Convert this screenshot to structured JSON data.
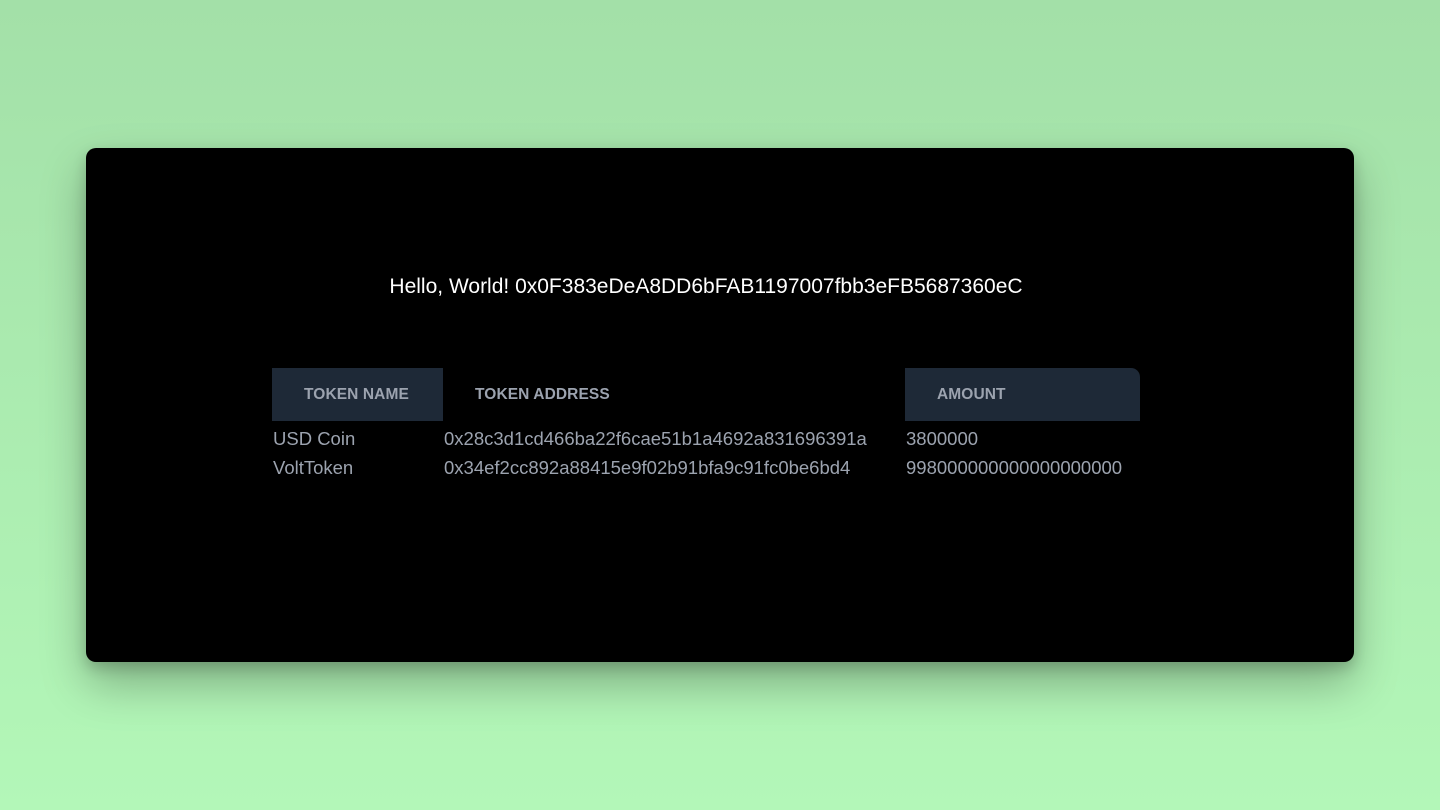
{
  "app": {
    "greeting": "Hello, World! 0x0F383eDeA8DD6bFAB1197007fbb3eFB5687360eC"
  },
  "table": {
    "headers": {
      "name": "TOKEN NAME",
      "address": "TOKEN ADDRESS",
      "amount": "AMOUNT"
    },
    "rows": [
      {
        "name": "USD Coin",
        "address": "0x28c3d1cd466ba22f6cae51b1a4692a831696391a",
        "amount": "3800000"
      },
      {
        "name": "VoltToken",
        "address": "0x34ef2cc892a88415e9f02b91bfa9c91fc0be6bd4",
        "amount": "998000000000000000000"
      }
    ]
  },
  "colors": {
    "background_top": "#a3e0a8",
    "background_bottom": "#b3f7b8",
    "window": "#000000",
    "header_cell": "#1e2937",
    "muted_text": "#9ca3af",
    "primary_text": "#ffffff"
  }
}
